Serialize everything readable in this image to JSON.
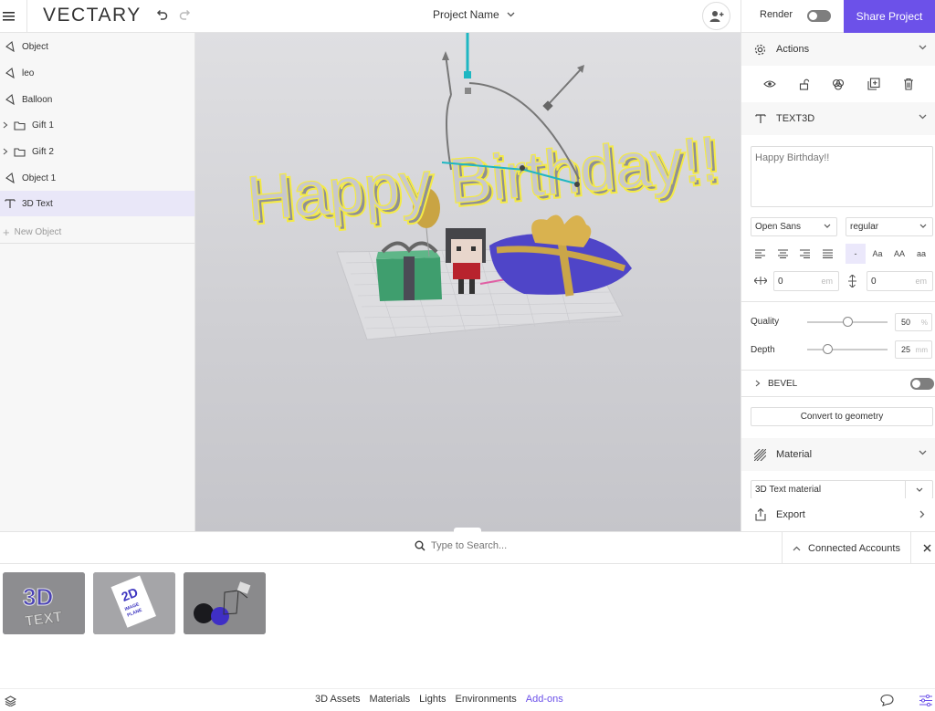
{
  "header": {
    "logo": "VECTARY",
    "project_name": "Project Name",
    "render_label": "Render",
    "share_label": "Share Project"
  },
  "outliner": {
    "items": [
      {
        "label": "Object",
        "icon": "mesh-icon",
        "expandable": false
      },
      {
        "label": "leo",
        "icon": "mesh-icon",
        "expandable": false
      },
      {
        "label": "Balloon",
        "icon": "mesh-icon",
        "expandable": false
      },
      {
        "label": "Gift 1",
        "icon": "folder-icon",
        "expandable": true
      },
      {
        "label": "Gift 2",
        "icon": "folder-icon",
        "expandable": true
      },
      {
        "label": "Object 1",
        "icon": "mesh-icon",
        "expandable": false
      },
      {
        "label": "3D Text",
        "icon": "text-icon",
        "expandable": false,
        "selected": true
      }
    ],
    "new_object_label": "New Object"
  },
  "viewport": {
    "scene_text": "Happy Birthday!!"
  },
  "panel": {
    "actions_title": "Actions",
    "text3d_title": "TEXT3D",
    "text_value": "Happy Birthday!!",
    "font_family": "Open Sans",
    "font_style": "regular",
    "case_options": [
      "-",
      "Aa",
      "AA",
      "aa"
    ],
    "letter_spacing": "0",
    "line_height": "0",
    "unit_em": "em",
    "quality_label": "Quality",
    "quality_value": "50",
    "quality_unit": "%",
    "quality_fraction": 0.5,
    "depth_label": "Depth",
    "depth_value": "25",
    "depth_unit": "mm",
    "depth_fraction": 0.25,
    "bevel_label": "BEVEL",
    "convert_label": "Convert to geometry",
    "material_title": "Material",
    "material_value": "3D Text material",
    "export_title": "Export"
  },
  "library": {
    "search_placeholder": "Type to Search...",
    "connected_label": "Connected Accounts",
    "cards": [
      "3D Text",
      "2D Image Plane",
      "Shapes"
    ],
    "tabs": [
      {
        "label": "3D Assets",
        "active": false
      },
      {
        "label": "Materials",
        "active": false
      },
      {
        "label": "Lights",
        "active": false
      },
      {
        "label": "Environments",
        "active": false
      },
      {
        "label": "Add-ons",
        "active": true
      }
    ]
  },
  "colors": {
    "accent": "#6c51e9",
    "selection": "#e9e7f8"
  }
}
